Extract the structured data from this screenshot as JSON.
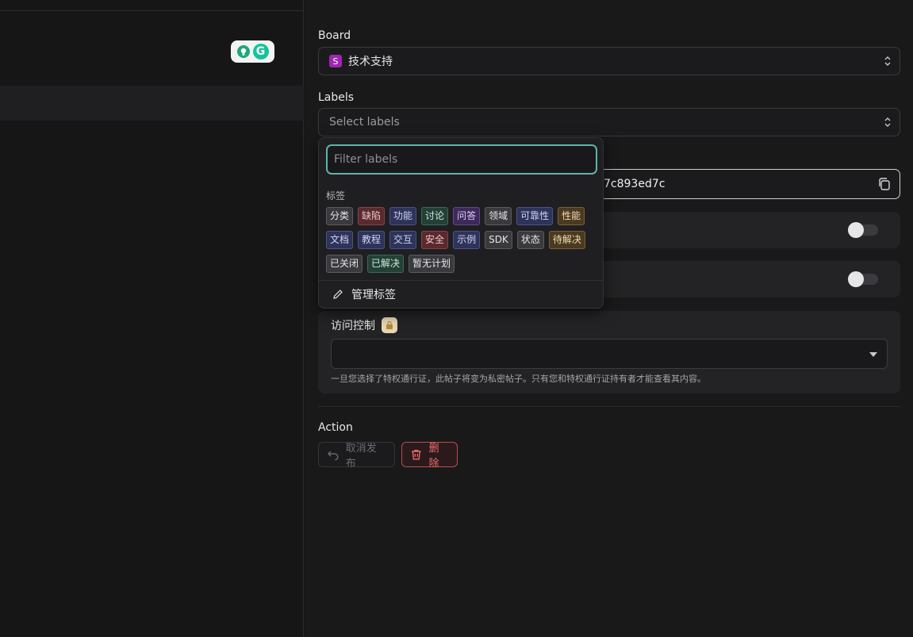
{
  "extension": {
    "grammarly_letter": "G"
  },
  "board": {
    "label": "Board",
    "badge": "S",
    "badge_color": "#9c27b0",
    "value": "技术支持"
  },
  "labels_field": {
    "label": "Labels",
    "placeholder": "Select labels"
  },
  "id_field": {
    "value": "7c893ed7c"
  },
  "access": {
    "title": "访问控制",
    "hint": "一旦您选择了特权通行证，此帖子将变为私密帖子。只有您和特权通行证持有者才能查看其内容。"
  },
  "action": {
    "label": "Action",
    "unpublish_label": "取消发布",
    "delete_label": "删除"
  },
  "label_dropdown": {
    "filter_placeholder": "Filter labels",
    "group_title": "标签",
    "tags": [
      {
        "text": "分类",
        "bg": "#3a3a3e",
        "border": "#5a5a60",
        "color": "#e6e6e8"
      },
      {
        "text": "缺陷",
        "bg": "#5a2a2e",
        "border": "#8a4248",
        "color": "#f0c8cb"
      },
      {
        "text": "功能",
        "bg": "#2e335a",
        "border": "#4b528a",
        "color": "#cfd3f5"
      },
      {
        "text": "讨论",
        "bg": "#244036",
        "border": "#3c6a58",
        "color": "#c6ead9"
      },
      {
        "text": "问答",
        "bg": "#3e2a5a",
        "border": "#63468a",
        "color": "#dfcdf6"
      },
      {
        "text": "领域",
        "bg": "#3a3a3e",
        "border": "#5a5a60",
        "color": "#e6e6e8"
      },
      {
        "text": "可靠性",
        "bg": "#2e335a",
        "border": "#4b528a",
        "color": "#cfd3f5"
      },
      {
        "text": "性能",
        "bg": "#4a3a22",
        "border": "#7a6034",
        "color": "#f2dcb0"
      },
      {
        "text": "文档",
        "bg": "#2e335a",
        "border": "#4b528a",
        "color": "#cfd3f5"
      },
      {
        "text": "教程",
        "bg": "#2e335a",
        "border": "#4b528a",
        "color": "#cfd3f5"
      },
      {
        "text": "交互",
        "bg": "#2e335a",
        "border": "#4b528a",
        "color": "#cfd3f5"
      },
      {
        "text": "安全",
        "bg": "#5a2a2e",
        "border": "#8a4248",
        "color": "#f0c8cb"
      },
      {
        "text": "示例",
        "bg": "#2e335a",
        "border": "#4b528a",
        "color": "#cfd3f5"
      },
      {
        "text": "SDK",
        "bg": "#3a3a3e",
        "border": "#5a5a60",
        "color": "#e6e6e8"
      },
      {
        "text": "状态",
        "bg": "#3a3a3e",
        "border": "#5a5a60",
        "color": "#e6e6e8"
      },
      {
        "text": "待解决",
        "bg": "#4a3a22",
        "border": "#7a6034",
        "color": "#f2dcb0"
      },
      {
        "text": "已关闭",
        "bg": "#3a3a3e",
        "border": "#5a5a60",
        "color": "#e6e6e8"
      },
      {
        "text": "已解决",
        "bg": "#244036",
        "border": "#3c6a58",
        "color": "#c6ead9"
      },
      {
        "text": "暂无计划",
        "bg": "#3a3a3e",
        "border": "#5a5a60",
        "color": "#e6e6e8"
      }
    ],
    "manage_label": "管理标签"
  }
}
